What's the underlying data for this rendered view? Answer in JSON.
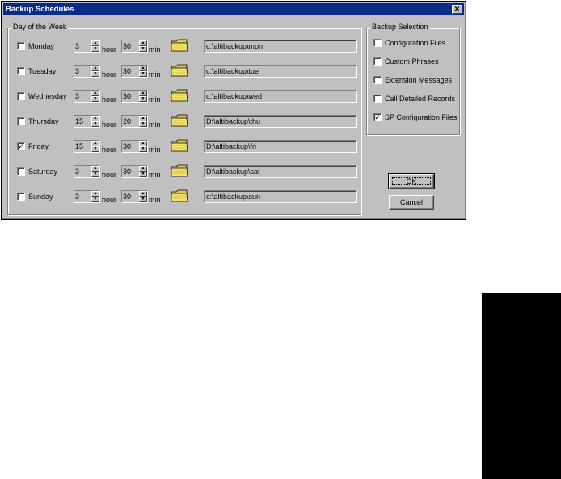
{
  "window": {
    "title": "Backup Schedules",
    "close_glyph": "✕"
  },
  "schedule_group": {
    "title": "Day of the Week",
    "hour_label": "hour",
    "min_label": "min",
    "days": [
      {
        "day": "Monday",
        "checked": false,
        "hour": "3",
        "min": "30",
        "path": "c:\\altibackup\\mon"
      },
      {
        "day": "Tuesday",
        "checked": false,
        "hour": "3",
        "min": "30",
        "path": "c:\\altibackup\\tue"
      },
      {
        "day": "Wednesday",
        "checked": false,
        "hour": "3",
        "min": "30",
        "path": "c:\\altibackup\\wed"
      },
      {
        "day": "Thursday",
        "checked": false,
        "hour": "15",
        "min": "20",
        "path": "D:\\altibackup\\thu"
      },
      {
        "day": "Friday",
        "checked": true,
        "hour": "15",
        "min": "30",
        "path": "D:\\altibackup\\fri"
      },
      {
        "day": "Saturday",
        "checked": false,
        "hour": "3",
        "min": "30",
        "path": "D:\\altibackup\\sat"
      },
      {
        "day": "Sunday",
        "checked": false,
        "hour": "3",
        "min": "30",
        "path": "c:\\altibackup\\sun"
      }
    ]
  },
  "backup_selection": {
    "title": "Backup Selection",
    "items": [
      {
        "label": "Configuration Files",
        "checked": false
      },
      {
        "label": "Custom Phrases",
        "checked": false
      },
      {
        "label": "Extension Messages",
        "checked": false
      },
      {
        "label": "Call Detailed Records",
        "checked": false
      },
      {
        "label": "SP Configuration Files",
        "checked": true
      }
    ]
  },
  "buttons": {
    "ok": "OK",
    "cancel": "Cancel"
  },
  "colors": {
    "titlebar": "#0a2a8c",
    "face": "#c0c0c0",
    "folder": "#f5e36a"
  }
}
